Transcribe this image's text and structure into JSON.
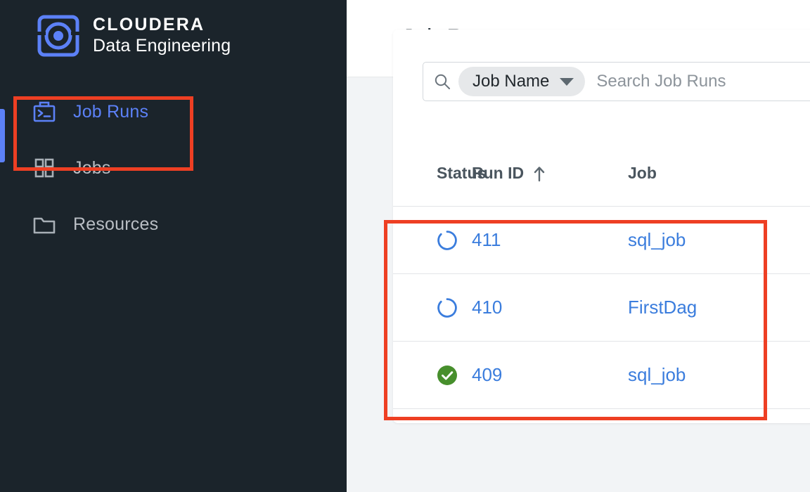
{
  "brand": {
    "logo_icon": "cloudera-logo-icon",
    "line1": "CLOUDERA",
    "line2": "Data Engineering"
  },
  "sidebar": {
    "items": [
      {
        "label": "Job Runs",
        "icon": "job-runs-terminal-icon",
        "active": true
      },
      {
        "label": "Jobs",
        "icon": "grid-icon",
        "active": false
      },
      {
        "label": "Resources",
        "icon": "folder-icon",
        "active": false
      }
    ]
  },
  "header": {
    "title": "Job Runs"
  },
  "search": {
    "icon": "search-icon",
    "filter_label": "Job Name",
    "caret_icon": "chevron-down-icon",
    "placeholder": "Search Job Runs",
    "value": ""
  },
  "table": {
    "columns": [
      {
        "key": "status",
        "label": "Status"
      },
      {
        "key": "run_id",
        "label": "Run ID",
        "sort": "asc",
        "sort_icon": "arrow-up-icon"
      },
      {
        "key": "job",
        "label": "Job"
      }
    ],
    "rows": [
      {
        "status": "running",
        "status_icon": "spinner-icon",
        "run_id": "411",
        "job": "sql_job"
      },
      {
        "status": "running",
        "status_icon": "spinner-icon",
        "run_id": "410",
        "job": "FirstDag"
      },
      {
        "status": "succeeded",
        "status_icon": "check-circle-icon",
        "run_id": "409",
        "job": "sql_job"
      }
    ]
  },
  "annotations": [
    {
      "name": "highlight-job-runs-nav",
      "color": "#ee3f23"
    },
    {
      "name": "highlight-table-top-rows",
      "color": "#ee3f23"
    }
  ],
  "colors": {
    "sidebar_bg": "#1b242b",
    "accent_blue": "#5c81f7",
    "link_blue": "#3b7ddd",
    "success_green": "#478f2c",
    "annotation_red": "#ee3f23",
    "page_bg": "#f2f4f6"
  }
}
